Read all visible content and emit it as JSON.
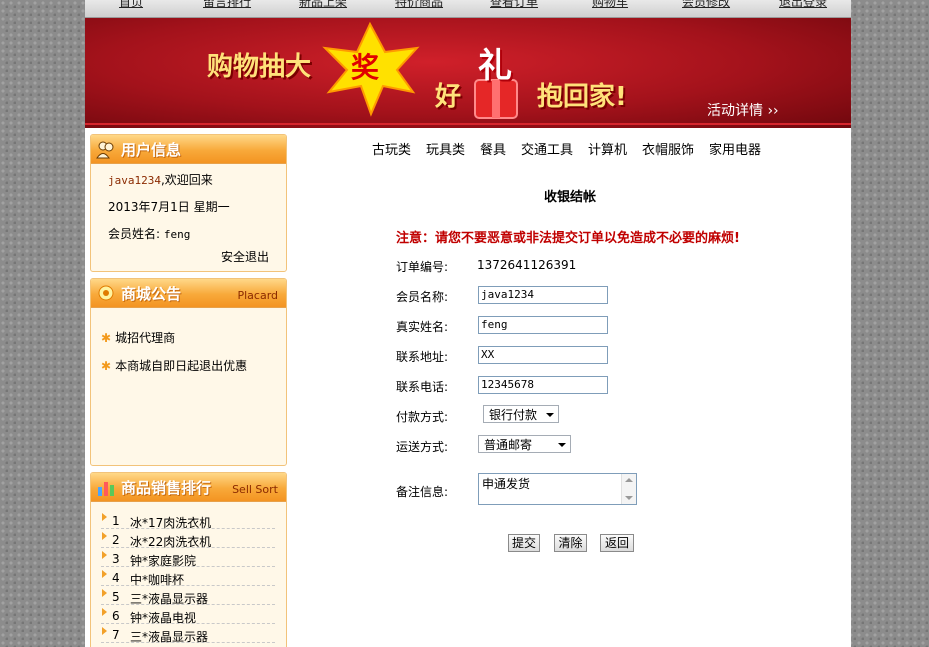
{
  "top_nav": [
    "首页",
    "留言排行",
    "新品上架",
    "特价商品",
    "查看订单",
    "购物车",
    "会员修改",
    "退出登录"
  ],
  "banner": {
    "text_left": "购物抽大",
    "text_star": "奖",
    "text_good": "好",
    "text_gift": "礼",
    "text_right": "抱回家!",
    "detail_link": "活动详情 ››"
  },
  "user_panel": {
    "title": "用户信息",
    "username": "java1234",
    "welcome": ",欢迎回来",
    "date": "2013年7月1日  星期一",
    "member_label": "会员姓名:",
    "member_name": "feng",
    "logout": "安全退出"
  },
  "notice_panel": {
    "title": "商城公告",
    "subtitle": "Placard",
    "items": [
      "城招代理商",
      "本商城自即日起退出优惠"
    ]
  },
  "sales_panel": {
    "title": "商品销售排行",
    "subtitle": "Sell Sort",
    "items": [
      {
        "rank": "1",
        "name": "冰*17肉洗衣机"
      },
      {
        "rank": "2",
        "name": "冰*22肉洗衣机"
      },
      {
        "rank": "3",
        "name": "钟*家庭影院"
      },
      {
        "rank": "4",
        "name": "中*咖啡杯"
      },
      {
        "rank": "5",
        "name": "三*液晶显示器"
      },
      {
        "rank": "6",
        "name": "钟*液晶电视"
      },
      {
        "rank": "7",
        "name": "三*液晶显示器"
      }
    ]
  },
  "categories": [
    "古玩类",
    "玩具类",
    "餐具",
    "交通工具",
    "计算机",
    "衣帽服饰",
    "家用电器"
  ],
  "checkout": {
    "title": "收银结帐",
    "warning": "注意：请您不要恶意或非法提交订单以免造成不必要的麻烦!",
    "order_no_label": "订单编号:",
    "order_no": "1372641126391",
    "member_label": "会员名称:",
    "member_value": "java1234",
    "realname_label": "真实姓名:",
    "realname_value": "feng",
    "address_label": "联系地址:",
    "address_value": "XX",
    "phone_label": "联系电话:",
    "phone_value": "12345678",
    "payment_label": "付款方式:",
    "payment_value": "银行付款",
    "shipping_label": "运送方式:",
    "shipping_value": "普通邮寄",
    "remark_label": "备注信息:",
    "remark_value": "申通发货",
    "submit": "提交",
    "clear": "清除",
    "back": "返回"
  },
  "colors": {
    "accent_orange": "#f39422",
    "warning_red": "#c00000",
    "banner_red": "#a3121b"
  }
}
